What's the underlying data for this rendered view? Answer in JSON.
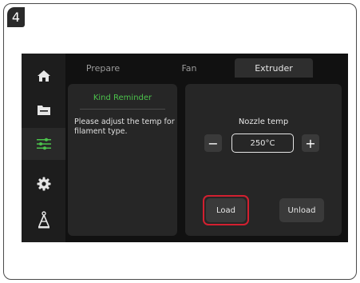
{
  "step_number": "4",
  "sidebar": {
    "items": [
      {
        "icon": "home-icon"
      },
      {
        "icon": "folder-icon"
      },
      {
        "icon": "sliders-icon",
        "active": true
      },
      {
        "icon": "gear-icon"
      },
      {
        "icon": "printer-icon"
      }
    ]
  },
  "tabs": [
    {
      "label": "Prepare"
    },
    {
      "label": "Fan"
    },
    {
      "label": "Extruder",
      "active": true
    }
  ],
  "reminder": {
    "title": "Kind Reminder",
    "text": "Please adjust the temp for filament type."
  },
  "extruder": {
    "nozzle_label": "Nozzle temp",
    "decrease_label": "−",
    "increase_label": "+",
    "temp_value": "250°C",
    "load_label": "Load",
    "unload_label": "Unload"
  },
  "colors": {
    "accent_green": "#4cc24c",
    "highlight_red": "#d22030"
  }
}
